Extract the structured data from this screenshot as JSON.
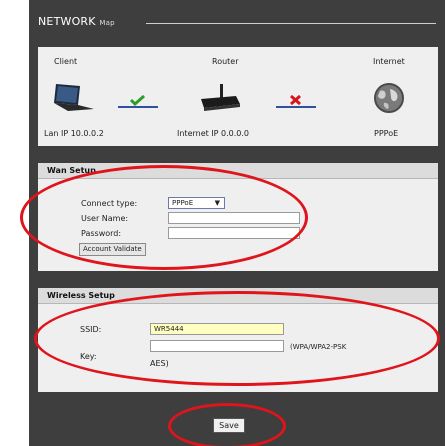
{
  "header": {
    "title": "NETWORK",
    "title_suffix": "Map"
  },
  "map": {
    "client_label": "Client",
    "router_label": "Router",
    "internet_label": "Internet",
    "client_status": "Lan IP 10.0.0.2",
    "router_status": "Internet IP 0.0.0.0",
    "internet_status": "PPPoE",
    "icons": {
      "client": "laptop-icon",
      "client_link": "check-icon",
      "router": "router-icon",
      "router_link": "cross-icon",
      "internet": "globe-icon"
    },
    "colors": {
      "ok": "#2a9d2a",
      "error": "#d9141a",
      "link_line": "#3050a0"
    }
  },
  "wan": {
    "heading": "Wan Setup",
    "connect_type_label": "Connect type:",
    "connect_type_value": "PPPoE",
    "username_label": "User Name:",
    "username_value": "",
    "password_label": "Password:",
    "password_value": "",
    "validate_button": "Account Validate"
  },
  "wireless": {
    "heading": "Wireless Setup",
    "ssid_label": "SSID:",
    "ssid_value": "WR5444",
    "key_label": "Key:",
    "key_value": "",
    "security_hint": "(WPA/WPA2-PSK",
    "security_hint_cont": "AES)"
  },
  "footer": {
    "save_label": "Save"
  },
  "annotation_color": "#e0141b"
}
